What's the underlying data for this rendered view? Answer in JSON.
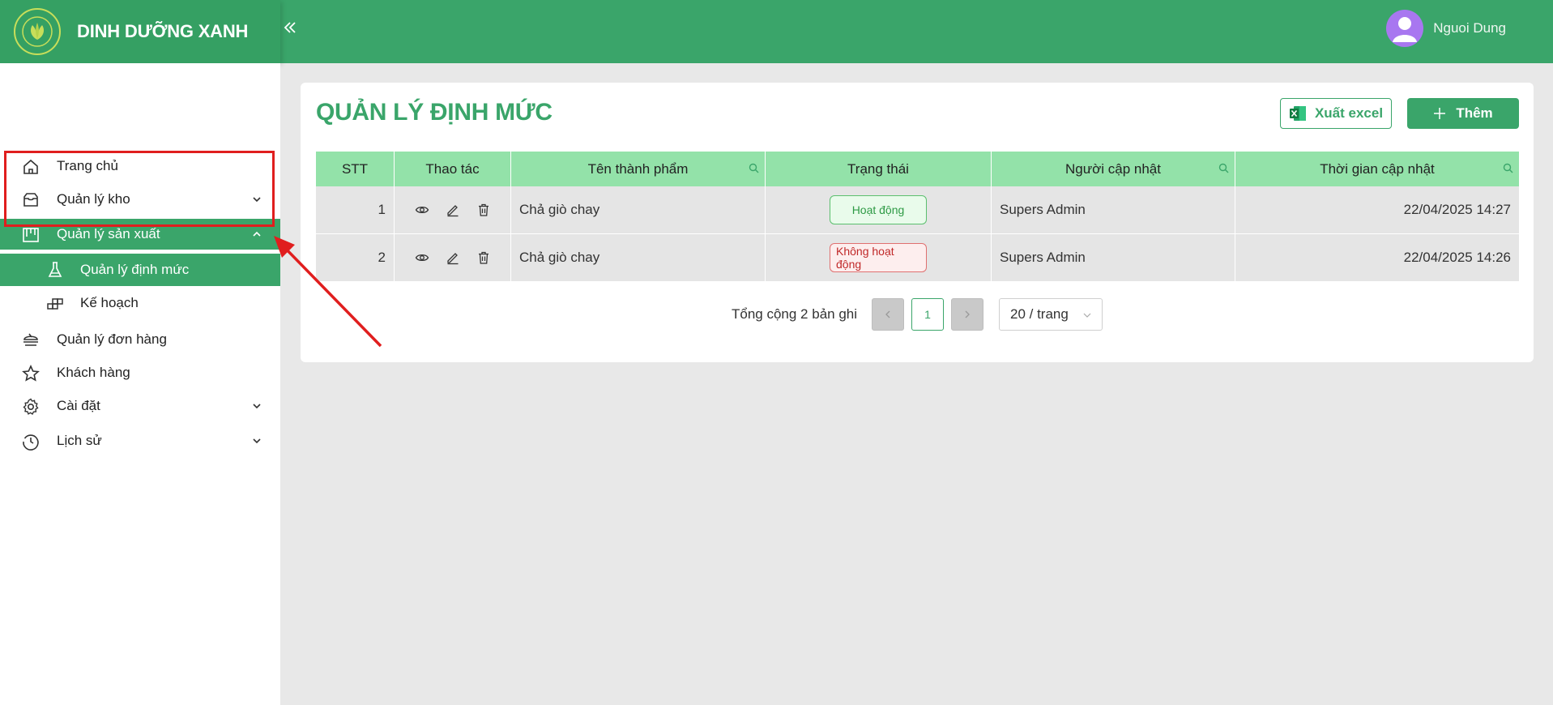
{
  "header": {
    "brand": "DINH DƯỠNG XANH",
    "collapse_icon": "double-chevron-left-icon",
    "user_name": "Nguoi Dung"
  },
  "sidebar": {
    "items": [
      {
        "label": "Trang chủ",
        "icon": "home-icon"
      },
      {
        "label": "Quản lý kho",
        "icon": "inbox-icon"
      },
      {
        "label": "Quản lý sản xuất",
        "icon": "production-icon"
      },
      {
        "label": "Quản lý định mức",
        "icon": "flask-icon"
      },
      {
        "label": "Kế hoạch",
        "icon": "blocks-icon"
      },
      {
        "label": "Quản lý đơn hàng",
        "icon": "order-icon"
      },
      {
        "label": "Khách hàng",
        "icon": "star-icon"
      },
      {
        "label": "Cài đặt",
        "icon": "gear-icon"
      },
      {
        "label": "Lịch sử",
        "icon": "history-icon"
      }
    ]
  },
  "main": {
    "title": "QUẢN LÝ ĐỊNH MỨC",
    "export_label": "Xuất excel",
    "add_label": "Thêm"
  },
  "table": {
    "columns": [
      "STT",
      "Thao tác",
      "Tên thành phẩm",
      "Trạng thái",
      "Người cập nhật",
      "Thời gian cập nhật"
    ],
    "rows": [
      {
        "stt": "1",
        "name": "Chả giò chay",
        "status": "Hoạt động",
        "user": "Supers Admin",
        "time": "22/04/2025 14:27"
      },
      {
        "stt": "2",
        "name": "Chả giò chay",
        "status": "Không hoạt động",
        "user": "Supers Admin",
        "time": "22/04/2025 14:26"
      }
    ]
  },
  "pagination": {
    "total_text": "Tổng cộng 2 bản ghi",
    "current_page": "1",
    "page_size": "20 / trang"
  },
  "colors": {
    "brand": "#3aa56a",
    "table_header": "#93e2a9",
    "highlight": "#e01e1e"
  }
}
